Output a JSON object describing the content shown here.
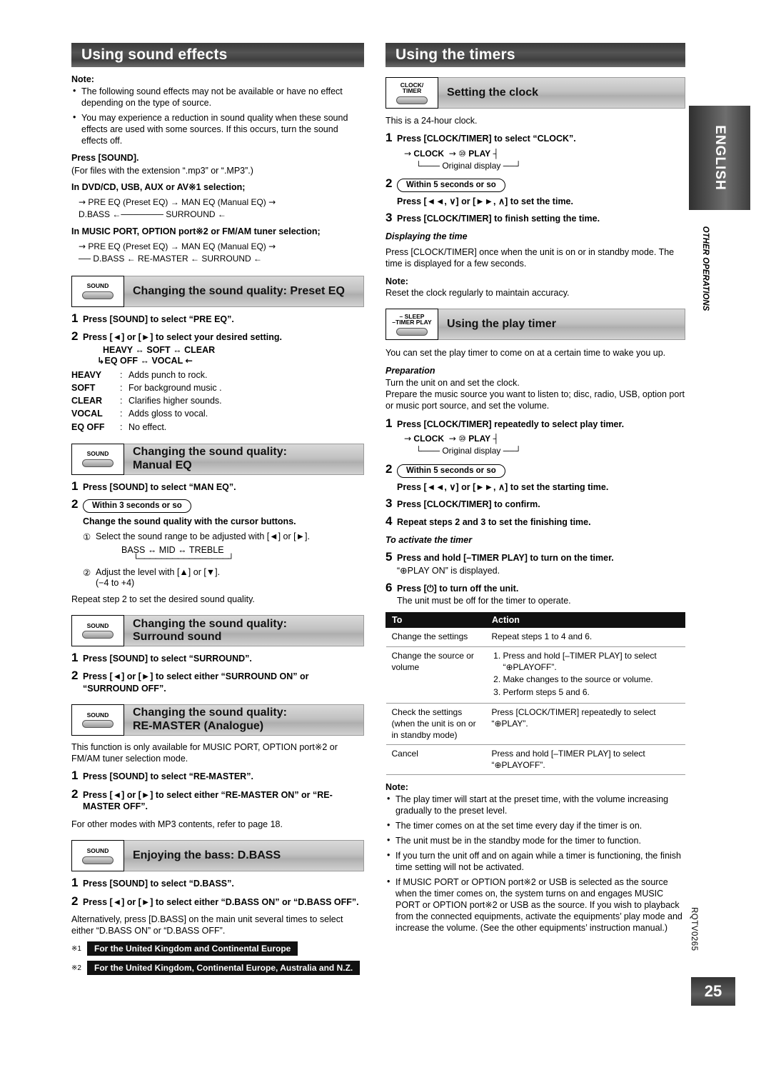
{
  "page": {
    "number": "25",
    "side_code": "RQTV0265",
    "tab_english": "ENGLISH",
    "tab_other": "OTHER OPERATIONS"
  },
  "left": {
    "banner": "Using sound effects",
    "note_label": "Note:",
    "notes": [
      "The following sound effects may not be available or have no effect depending on the type of source.",
      "You may experience a reduction in sound quality when these sound effects are used with some sources. If this occurs, turn the sound effects off."
    ],
    "press_sound": "Press [SOUND].",
    "press_sound_sub": "(For files with the extension “.mp3” or “.MP3”.)",
    "sel1_title": "In DVD/CD, USB, AUX or AV※1 selection;",
    "sel1_line1": "PRE EQ (Preset EQ) → MAN EQ (Manual EQ)",
    "sel1_line2": "D.BASS ←─────── SURROUND ←",
    "sel2_title": "In MUSIC PORT, OPTION port※2 or FM/AM tuner selection;",
    "sel2_line1": "PRE EQ (Preset EQ) → MAN EQ (Manual EQ)",
    "sel2_line2": "D.BASS ← RE-MASTER ← SURROUND ←",
    "preset": {
      "icon_caption": "SOUND",
      "title": "Changing the sound quality: Preset EQ",
      "step1": "Press [SOUND] to select “PRE EQ”.",
      "step2": "Press [◄] or [►] to select your desired setting.",
      "cycle1": "HEAVY ↔ SOFT ↔ CLEAR",
      "cycle2": "EQ OFF ↔ VOCAL",
      "defs": [
        {
          "k": "HEAVY",
          "v": "Adds punch to rock."
        },
        {
          "k": "SOFT",
          "v": "For background music ."
        },
        {
          "k": "CLEAR",
          "v": "Clarifies higher sounds."
        },
        {
          "k": "VOCAL",
          "v": "Adds gloss to vocal."
        },
        {
          "k": "EQ OFF",
          "v": "No effect."
        }
      ]
    },
    "manual": {
      "icon_caption": "SOUND",
      "title_l1": "Changing the sound quality:",
      "title_l2": "Manual EQ",
      "step1": "Press [SOUND] to select “MAN EQ”.",
      "step2_badge": "Within 3 seconds or so",
      "step2_text": "Change the sound quality with the cursor buttons.",
      "sub1": "Select the sound range to be adjusted with [◄] or [►].",
      "range": "BASS ↔ MID ↔ TREBLE",
      "sub2": "Adjust the level with [▲] or [▼].",
      "sub2_range": "(−4 to +4)",
      "repeat": "Repeat step 2 to set the desired sound quality."
    },
    "surround": {
      "icon_caption": "SOUND",
      "title_l1": "Changing the sound quality:",
      "title_l2": "Surround sound",
      "step1": "Press [SOUND] to select “SURROUND”.",
      "step2": "Press [◄] or [►] to select either “SURROUND ON” or “SURROUND OFF”."
    },
    "remaster": {
      "icon_caption": "SOUND",
      "title_l1": "Changing the sound quality:",
      "title_l2": "RE-MASTER (Analogue)",
      "intro": "This function is only available for MUSIC PORT, OPTION port※2 or FM/AM tuner selection mode.",
      "step1": "Press [SOUND] to select “RE-MASTER”.",
      "step2": "Press [◄] or [►] to select either “RE-MASTER ON” or “RE-MASTER OFF”.",
      "after": "For other modes with MP3 contents, refer to page 18."
    },
    "dbass": {
      "icon_caption": "SOUND",
      "title": "Enjoying the bass: D.BASS",
      "step1": "Press [SOUND] to select “D.BASS”.",
      "step2": "Press [◄] or [►] to select either “D.BASS ON” or “D.BASS OFF”.",
      "after": "Alternatively, press [D.BASS] on the main unit several times to select either “D.BASS ON” or “D.BASS OFF”."
    },
    "footnote1_mark": "※1",
    "footnote1": "For the United Kingdom and Continental Europe",
    "footnote2_mark": "※2",
    "footnote2": "For the United Kingdom, Continental Europe, Australia and N.Z."
  },
  "right": {
    "banner": "Using the timers",
    "clock": {
      "icon_cap1": "CLOCK/",
      "icon_cap2": "TIMER",
      "title": "Setting the clock",
      "intro": "This is a 24-hour clock.",
      "step1": "Press [CLOCK/TIMER] to select “CLOCK”.",
      "flow_clock": "CLOCK",
      "flow_play": "PLAY",
      "flow_orig": "Original display",
      "step2_badge": "Within 5 seconds or so",
      "step2_text": "Press [◄◄, ∨] or [►►, ∧] to set the time.",
      "step3": "Press [CLOCK/TIMER] to finish setting the time.",
      "disp_title": "Displaying the time",
      "disp_body": "Press [CLOCK/TIMER] once when the unit is on or in standby mode. The time is displayed for a few seconds.",
      "note_label": "Note:",
      "note_body": "Reset the clock regularly to maintain accuracy."
    },
    "playtimer": {
      "icon_cap1": "– SLEEP",
      "icon_cap2": "–TIMER PLAY",
      "title": "Using the play timer",
      "intro": "You can set the play timer to come on at a certain time to wake you up.",
      "prep_title": "Preparation",
      "prep_l1": "Turn the unit on and set the clock.",
      "prep_l2": "Prepare the music source you want to listen to; disc, radio, USB, option port or music port source, and set the volume.",
      "step1": "Press [CLOCK/TIMER] repeatedly to select play timer.",
      "flow_clock": "CLOCK",
      "flow_play": "PLAY",
      "flow_orig": "Original display",
      "step2_badge": "Within 5 seconds or so",
      "step2_text": "Press [◄◄, ∨] or [►►, ∧] to set the starting time.",
      "step3": "Press [CLOCK/TIMER] to confirm.",
      "step4": "Repeat steps 2 and 3 to set the finishing time.",
      "activate_title": "To activate the timer",
      "step5": "Press and hold [–TIMER PLAY] to turn on the timer.",
      "step5_sub": "“⊕PLAY ON” is displayed.",
      "step6": "Press [⏻] to turn off the unit.",
      "step6_sub": "The unit must be off for the timer to operate.",
      "table": {
        "headers": [
          "To",
          "Action"
        ],
        "rows": [
          {
            "to": "Change the settings",
            "action_text": "Repeat steps 1 to 4 and 6.",
            "action_list": []
          },
          {
            "to": "Change the source or volume",
            "action_text": "",
            "action_list": [
              "Press and hold [–TIMER PLAY] to select “⊕PLAYOFF”.",
              "Make changes to the source or volume.",
              "Perform steps 5 and 6."
            ]
          },
          {
            "to": "Check the settings (when the unit is on or in standby mode)",
            "action_text": "Press [CLOCK/TIMER] repeatedly to select “⊕PLAY”.",
            "action_list": []
          },
          {
            "to": "Cancel",
            "action_text": "Press and hold [–TIMER PLAY] to select “⊕PLAYOFF”.",
            "action_list": []
          }
        ]
      },
      "note_label": "Note:",
      "notes": [
        "The play timer will start at the preset time, with the volume increasing gradually to the preset level.",
        "The timer comes on at the set time every day if the timer is on.",
        "The unit must be in the standby mode for the timer to function.",
        "If you turn the unit off and on again while a timer is functioning, the finish time setting will not be activated.",
        "If MUSIC PORT or OPTION port※2 or USB is selected as the source when the timer comes on, the system turns on and engages MUSIC PORT or OPTION port※2 or USB as the source. If you wish to playback from the connected equipments, activate the equipments’ play mode and increase the volume. (See the other equipments’ instruction manual.)"
      ]
    }
  }
}
